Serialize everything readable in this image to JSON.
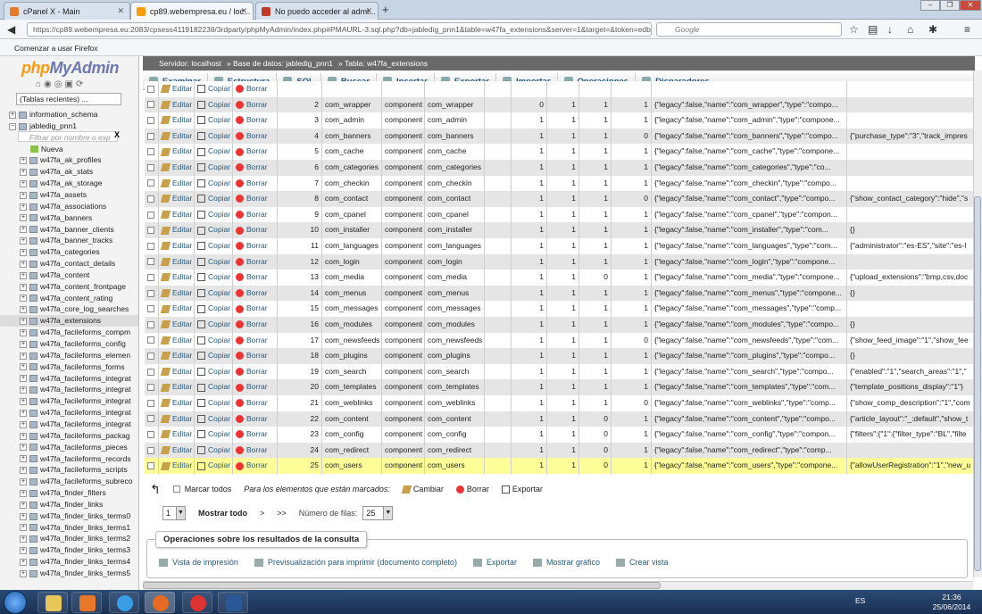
{
  "browser": {
    "tabs": [
      {
        "label": "cPanel X - Main"
      },
      {
        "label": "cp89.webempresa.eu / loc..."
      },
      {
        "label": "No puedo acceder al admi..."
      }
    ],
    "url": "https://cp89.webempresa.eu:2083/cpsess4119182238/3rdparty/phpMyAdmin/index.php#PMAURL-3:sql.php?db=jabledig_pnn1&table=w47fa_extensions&server=1&target=&token=edbd00ef71",
    "search_placeholder": "Google",
    "bookmark": "Comenzar a usar Firefox"
  },
  "sidebar": {
    "logo_php": "php",
    "logo_my": "MyAdmin",
    "recent": "(Tablas recientes) ...",
    "filter_placeholder": "Filtrar por nombre o exp",
    "filter_clear": "X",
    "new_label": "Nueva",
    "databases": [
      "information_schema",
      "jabledig_pnn1"
    ],
    "tables": [
      "w47fa_ak_profiles",
      "w47fa_ak_stats",
      "w47fa_ak_storage",
      "w47fa_assets",
      "w47fa_associations",
      "w47fa_banners",
      "w47fa_banner_clients",
      "w47fa_banner_tracks",
      "w47fa_categories",
      "w47fa_contact_details",
      "w47fa_content",
      "w47fa_content_frontpage",
      "w47fa_content_rating",
      "w47fa_core_log_searches",
      "w47fa_extensions",
      "w47fa_facileforms_compm",
      "w47fa_facileforms_config",
      "w47fa_facileforms_elemen",
      "w47fa_facileforms_forms",
      "w47fa_facileforms_integrat",
      "w47fa_facileforms_integrat",
      "w47fa_facileforms_integrat",
      "w47fa_facileforms_integrat",
      "w47fa_facileforms_integrat",
      "w47fa_facileforms_packag",
      "w47fa_facileforms_pieces",
      "w47fa_facileforms_records",
      "w47fa_facileforms_scripts",
      "w47fa_facileforms_subreco",
      "w47fa_finder_filters",
      "w47fa_finder_links",
      "w47fa_finder_links_terms0",
      "w47fa_finder_links_terms1",
      "w47fa_finder_links_terms2",
      "w47fa_finder_links_terms3",
      "w47fa_finder_links_terms4",
      "w47fa_finder_links_terms5"
    ],
    "selected_table": "w47fa_extensions"
  },
  "breadcrumb": {
    "server": "Servidor: localhost",
    "database": "Base de datos: jabledig_pnn1",
    "table": "Tabla: w47fa_extensions"
  },
  "menu": [
    "Examinar",
    "Estructura",
    "SQL",
    "Buscar",
    "Insertar",
    "Exportar",
    "Importar",
    "Operaciones",
    "Disparadores"
  ],
  "actions": {
    "edit": "Editar",
    "copy": "Copiar",
    "delete": "Borrar"
  },
  "rows": [
    {
      "id": "2",
      "name": "com_wrapper",
      "type": "component",
      "element": "com_wrapper",
      "c1": "0",
      "c2": "1",
      "c3": "1",
      "c4": "1",
      "manifest": "{\"legacy\":false,\"name\":\"com_wrapper\",\"type\":\"compo...",
      "params": ""
    },
    {
      "id": "3",
      "name": "com_admin",
      "type": "component",
      "element": "com_admin",
      "c1": "1",
      "c2": "1",
      "c3": "1",
      "c4": "1",
      "manifest": "{\"legacy\":false,\"name\":\"com_admin\",\"type\":\"compone...",
      "params": ""
    },
    {
      "id": "4",
      "name": "com_banners",
      "type": "component",
      "element": "com_banners",
      "c1": "1",
      "c2": "1",
      "c3": "1",
      "c4": "0",
      "manifest": "{\"legacy\":false,\"name\":\"com_banners\",\"type\":\"compo...",
      "params": "{\"purchase_type\":\"3\",\"track_impres"
    },
    {
      "id": "5",
      "name": "com_cache",
      "type": "component",
      "element": "com_cache",
      "c1": "1",
      "c2": "1",
      "c3": "1",
      "c4": "1",
      "manifest": "{\"legacy\":false,\"name\":\"com_cache\",\"type\":\"compone...",
      "params": ""
    },
    {
      "id": "6",
      "name": "com_categories",
      "type": "component",
      "element": "com_categories",
      "c1": "1",
      "c2": "1",
      "c3": "1",
      "c4": "1",
      "manifest": "{\"legacy\":false,\"name\":\"com_categories\",\"type\":\"co...",
      "params": ""
    },
    {
      "id": "7",
      "name": "com_checkin",
      "type": "component",
      "element": "com_checkin",
      "c1": "1",
      "c2": "1",
      "c3": "1",
      "c4": "1",
      "manifest": "{\"legacy\":false,\"name\":\"com_checkin\",\"type\":\"compo...",
      "params": ""
    },
    {
      "id": "8",
      "name": "com_contact",
      "type": "component",
      "element": "com_contact",
      "c1": "1",
      "c2": "1",
      "c3": "1",
      "c4": "0",
      "manifest": "{\"legacy\":false,\"name\":\"com_contact\",\"type\":\"compo...",
      "params": "{\"show_contact_category\":\"hide\",\"s"
    },
    {
      "id": "9",
      "name": "com_cpanel",
      "type": "component",
      "element": "com_cpanel",
      "c1": "1",
      "c2": "1",
      "c3": "1",
      "c4": "1",
      "manifest": "{\"legacy\":false,\"name\":\"com_cpanel\",\"type\":\"compon...",
      "params": ""
    },
    {
      "id": "10",
      "name": "com_installer",
      "type": "component",
      "element": "com_installer",
      "c1": "1",
      "c2": "1",
      "c3": "1",
      "c4": "1",
      "manifest": "{\"legacy\":false,\"name\":\"com_installer\",\"type\":\"com...",
      "params": "{}"
    },
    {
      "id": "11",
      "name": "com_languages",
      "type": "component",
      "element": "com_languages",
      "c1": "1",
      "c2": "1",
      "c3": "1",
      "c4": "1",
      "manifest": "{\"legacy\":false,\"name\":\"com_languages\",\"type\":\"com...",
      "params": "{\"administrator\":\"es-ES\",\"site\":\"es-l"
    },
    {
      "id": "12",
      "name": "com_login",
      "type": "component",
      "element": "com_login",
      "c1": "1",
      "c2": "1",
      "c3": "1",
      "c4": "1",
      "manifest": "{\"legacy\":false,\"name\":\"com_login\",\"type\":\"compone...",
      "params": ""
    },
    {
      "id": "13",
      "name": "com_media",
      "type": "component",
      "element": "com_media",
      "c1": "1",
      "c2": "1",
      "c3": "0",
      "c4": "1",
      "manifest": "{\"legacy\":false,\"name\":\"com_media\",\"type\":\"compone...",
      "params": "{\"upload_extensions\":\"bmp,csv,doc"
    },
    {
      "id": "14",
      "name": "com_menus",
      "type": "component",
      "element": "com_menus",
      "c1": "1",
      "c2": "1",
      "c3": "1",
      "c4": "1",
      "manifest": "{\"legacy\":false,\"name\":\"com_menus\",\"type\":\"compone...",
      "params": "{}"
    },
    {
      "id": "15",
      "name": "com_messages",
      "type": "component",
      "element": "com_messages",
      "c1": "1",
      "c2": "1",
      "c3": "1",
      "c4": "1",
      "manifest": "{\"legacy\":false,\"name\":\"com_messages\",\"type\":\"comp...",
      "params": ""
    },
    {
      "id": "16",
      "name": "com_modules",
      "type": "component",
      "element": "com_modules",
      "c1": "1",
      "c2": "1",
      "c3": "1",
      "c4": "1",
      "manifest": "{\"legacy\":false,\"name\":\"com_modules\",\"type\":\"compo...",
      "params": "{}"
    },
    {
      "id": "17",
      "name": "com_newsfeeds",
      "type": "component",
      "element": "com_newsfeeds",
      "c1": "1",
      "c2": "1",
      "c3": "1",
      "c4": "0",
      "manifest": "{\"legacy\":false,\"name\":\"com_newsfeeds\",\"type\":\"com...",
      "params": "{\"show_feed_image\":\"1\",\"show_fee"
    },
    {
      "id": "18",
      "name": "com_plugins",
      "type": "component",
      "element": "com_plugins",
      "c1": "1",
      "c2": "1",
      "c3": "1",
      "c4": "1",
      "manifest": "{\"legacy\":false,\"name\":\"com_plugins\",\"type\":\"compo...",
      "params": "{}"
    },
    {
      "id": "19",
      "name": "com_search",
      "type": "component",
      "element": "com_search",
      "c1": "1",
      "c2": "1",
      "c3": "1",
      "c4": "1",
      "manifest": "{\"legacy\":false,\"name\":\"com_search\",\"type\":\"compo...",
      "params": "{\"enabled\":\"1\",\"search_areas\":\"1\",\""
    },
    {
      "id": "20",
      "name": "com_templates",
      "type": "component",
      "element": "com_templates",
      "c1": "1",
      "c2": "1",
      "c3": "1",
      "c4": "1",
      "manifest": "{\"legacy\":false,\"name\":\"com_templates\",\"type\":\"com...",
      "params": "{\"template_positions_display\":\"1\"}"
    },
    {
      "id": "21",
      "name": "com_weblinks",
      "type": "component",
      "element": "com_weblinks",
      "c1": "1",
      "c2": "1",
      "c3": "1",
      "c4": "0",
      "manifest": "{\"legacy\":false,\"name\":\"com_weblinks\",\"type\":\"comp...",
      "params": "{\"show_comp_description\":\"1\",\"com"
    },
    {
      "id": "22",
      "name": "com_content",
      "type": "component",
      "element": "com_content",
      "c1": "1",
      "c2": "1",
      "c3": "0",
      "c4": "1",
      "manifest": "{\"legacy\":false,\"name\":\"com_content\",\"type\":\"compo...",
      "params": "{\"article_layout\":\"_:default\",\"show_t"
    },
    {
      "id": "23",
      "name": "com_config",
      "type": "component",
      "element": "com_config",
      "c1": "1",
      "c2": "1",
      "c3": "0",
      "c4": "1",
      "manifest": "{\"legacy\":false,\"name\":\"com_config\",\"type\":\"compon...",
      "params": "{\"filters\":{\"1\":{\"filter_type\":\"BL\",\"filte"
    },
    {
      "id": "24",
      "name": "com_redirect",
      "type": "component",
      "element": "com_redirect",
      "c1": "1",
      "c2": "1",
      "c3": "0",
      "c4": "1",
      "manifest": "{\"legacy\":false,\"name\":\"com_redirect\",\"type\":\"comp...",
      "params": ""
    },
    {
      "id": "25",
      "name": "com_users",
      "type": "component",
      "element": "com_users",
      "c1": "1",
      "c2": "1",
      "c3": "0",
      "c4": "1",
      "manifest": "{\"legacy\":false,\"name\":\"com_users\",\"type\":\"compone...",
      "params": "{\"allowUserRegistration\":\"1\",\"new_u"
    }
  ],
  "footer": {
    "mark_all": "Marcar todos",
    "with_selected": "Para los elementos que están marcados:",
    "change": "Cambiar",
    "delete": "Borrar",
    "export": "Exportar"
  },
  "pager": {
    "page": "1",
    "show_all": "Mostrar todo",
    "next": ">",
    "last": ">>",
    "rows_label": "Número de filas:",
    "rows_value": "25"
  },
  "operations": {
    "title": "Operaciones sobre los resultados de la consulta",
    "links": [
      "Vista de impresión",
      "Previsualización para imprimir (documento completo)",
      "Exportar",
      "Mostrar gráfico",
      "Crear vista"
    ]
  },
  "taskbar": {
    "lang": "ES",
    "time": "21:36",
    "date": "25/06/2014"
  }
}
